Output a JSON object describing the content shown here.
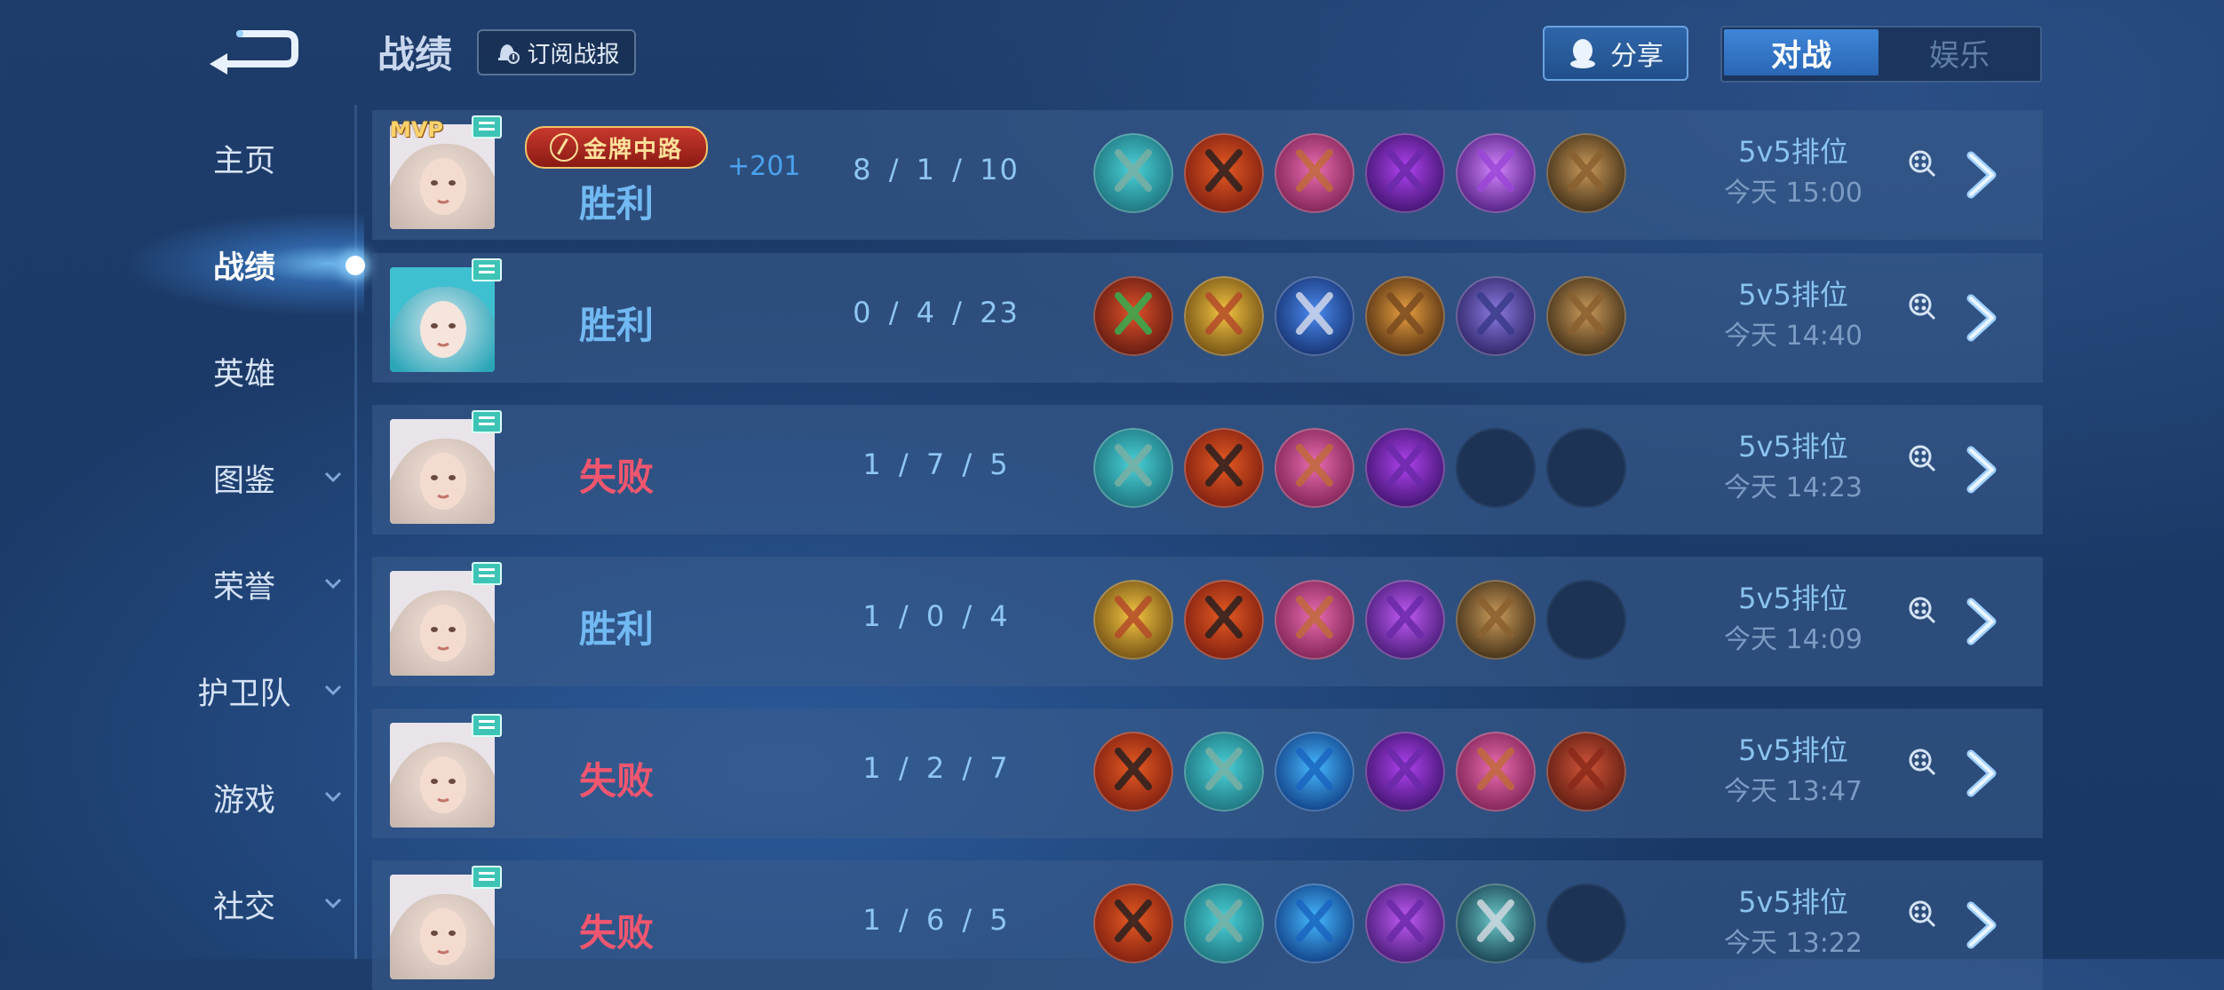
{
  "header": {
    "title": "战绩",
    "subscribe_label": "订阅战报",
    "share_label": "分享",
    "tabs": [
      "对战",
      "娱乐"
    ]
  },
  "sidebar": {
    "items": [
      {
        "label": "主页",
        "active": false,
        "has_arrow": false
      },
      {
        "label": "战绩",
        "active": true,
        "has_arrow": false
      },
      {
        "label": "英雄",
        "active": false,
        "has_arrow": false
      },
      {
        "label": "图鉴",
        "active": false,
        "has_arrow": true
      },
      {
        "label": "荣誉",
        "active": false,
        "has_arrow": true
      },
      {
        "label": "护卫队",
        "active": false,
        "has_arrow": true
      },
      {
        "label": "游戏",
        "active": false,
        "has_arrow": true
      },
      {
        "label": "社交",
        "active": false,
        "has_arrow": true
      }
    ]
  },
  "matches": [
    {
      "mvp": "MVP",
      "medal": "金牌中路",
      "result": "胜利",
      "outcome": "win",
      "gain": "+201",
      "kda": "8 / 1 / 10",
      "mode": "5v5排位",
      "time": "今天 15:00",
      "hero": "white",
      "items": [
        "boots-teal",
        "cross-staff",
        "book",
        "violet-blade",
        "purple-swirl",
        "wood-crate"
      ]
    },
    {
      "mvp": "",
      "medal": "",
      "result": "胜利",
      "outcome": "win",
      "gain": "",
      "kda": "0 / 4 / 23",
      "mode": "5v5排位",
      "time": "今天 14:40",
      "hero": "teal",
      "items": [
        "green-rune",
        "boots-gold",
        "blue-mask",
        "gold-armor",
        "violet-armor",
        "wood-crate"
      ]
    },
    {
      "mvp": "",
      "medal": "",
      "result": "失败",
      "outcome": "lose",
      "gain": "",
      "kda": "1 / 7 / 5",
      "mode": "5v5排位",
      "time": "今天 14:23",
      "hero": "white",
      "items": [
        "boots-teal",
        "cross-staff",
        "book",
        "violet-blade",
        "",
        ""
      ]
    },
    {
      "mvp": "",
      "medal": "",
      "result": "胜利",
      "outcome": "win",
      "gain": "",
      "kda": "1 / 0 / 4",
      "mode": "5v5排位",
      "time": "今天 14:09",
      "hero": "white",
      "items": [
        "boots-gold",
        "cross-staff",
        "book",
        "violet-staff",
        "wood-crate",
        ""
      ]
    },
    {
      "mvp": "",
      "medal": "",
      "result": "失败",
      "outcome": "lose",
      "gain": "",
      "kda": "1 / 2 / 7",
      "mode": "5v5排位",
      "time": "今天 13:47",
      "hero": "white",
      "items": [
        "cross-staff",
        "boots-teal",
        "blue-wave",
        "violet-blade",
        "book",
        "red-book"
      ]
    },
    {
      "mvp": "",
      "medal": "",
      "result": "失败",
      "outcome": "lose",
      "gain": "",
      "kda": "1 / 6 / 5",
      "mode": "5v5排位",
      "time": "今天 13:22",
      "hero": "white",
      "items": [
        "cross-staff",
        "boots-teal",
        "blue-wave",
        "violet-staff",
        "steel-lens",
        ""
      ]
    }
  ],
  "colors": {
    "win": "#71b9f2",
    "lose": "#f0566f",
    "accent": "#3f86d8"
  }
}
